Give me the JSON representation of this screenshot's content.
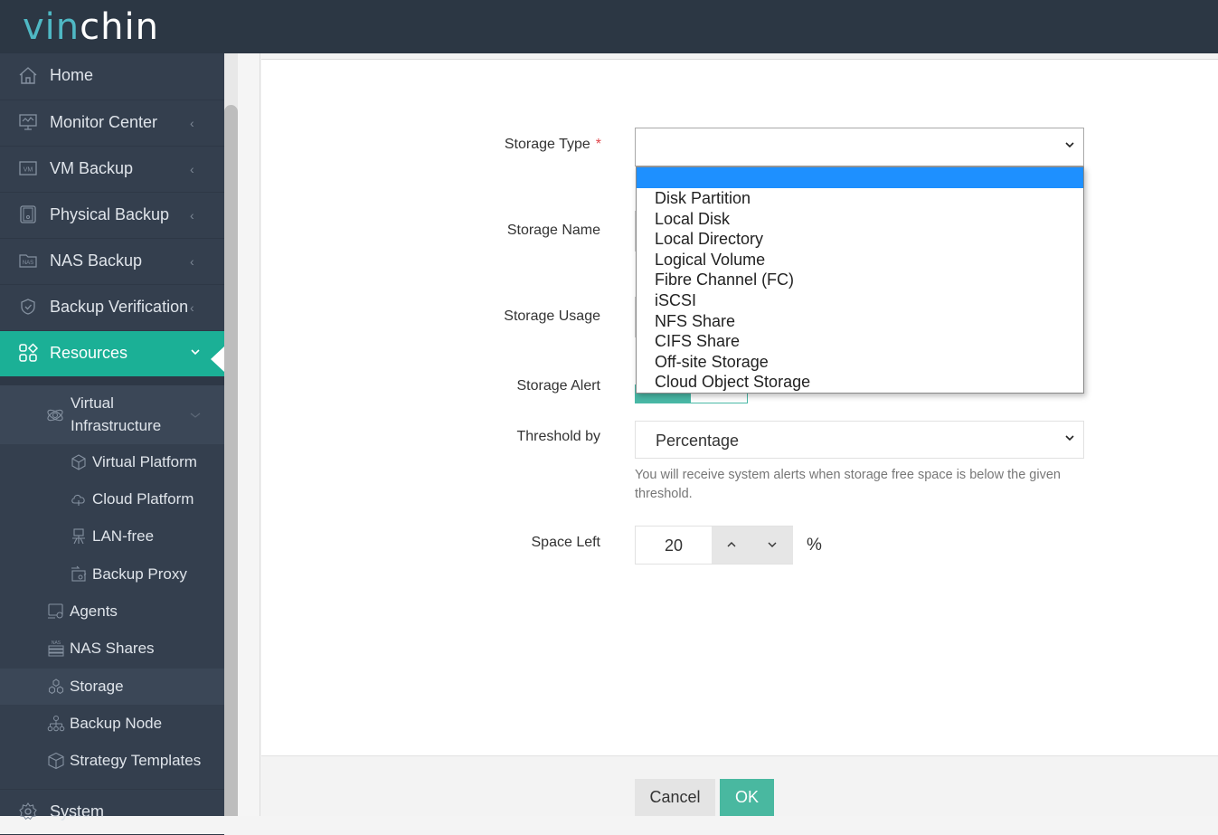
{
  "app": {
    "logo_part1": "vin",
    "logo_part2": "chin"
  },
  "sidebar": {
    "items": [
      {
        "label": "Home",
        "icon": "home-icon",
        "has_chevron": false
      },
      {
        "label": "Monitor Center",
        "icon": "monitor-icon",
        "chevron": "‹"
      },
      {
        "label": "VM Backup",
        "icon": "vm-icon",
        "chevron": "‹"
      },
      {
        "label": "Physical Backup",
        "icon": "server-icon",
        "chevron": "‹"
      },
      {
        "label": "NAS Backup",
        "icon": "nas-icon",
        "chevron": "‹"
      },
      {
        "label": "Backup Verification",
        "icon": "shield-check-icon",
        "chevron": "‹"
      },
      {
        "label": "Resources",
        "icon": "resources-icon",
        "chevron": "⌄",
        "active": true
      }
    ],
    "resources_sub": {
      "group_label_line1": "Virtual",
      "group_label_line2": "Infrastructure",
      "group_children": [
        {
          "label": "Virtual Platform",
          "icon": "cube-icon"
        },
        {
          "label": "Cloud Platform",
          "icon": "cloud-icon"
        },
        {
          "label": "LAN-free",
          "icon": "lan-free-icon"
        },
        {
          "label": "Backup Proxy",
          "icon": "proxy-icon"
        }
      ],
      "items": [
        {
          "label": "Agents",
          "icon": "agent-icon"
        },
        {
          "label": "NAS Shares",
          "icon": "nas-shares-icon"
        },
        {
          "label": "Storage",
          "icon": "storage-icon",
          "selected": true
        },
        {
          "label": "Backup Node",
          "icon": "node-icon"
        },
        {
          "label": "Strategy Templates",
          "icon": "template-icon"
        }
      ]
    },
    "bottom_item": {
      "label": "System",
      "icon": "gear-icon"
    }
  },
  "form": {
    "storage_type": {
      "label": "Storage Type",
      "required_mark": "*",
      "value": ""
    },
    "storage_name": {
      "label": "Storage Name"
    },
    "storage_usage": {
      "label": "Storage Usage"
    },
    "storage_alert": {
      "label": "Storage Alert",
      "enabled": true
    },
    "threshold_by": {
      "label": "Threshold by",
      "value": "Percentage"
    },
    "hint": "You will receive system alerts when storage free space is below the given threshold.",
    "space_left": {
      "label": "Space Left",
      "value": "20",
      "unit": "%"
    }
  },
  "dropdown": {
    "options": [
      "",
      "Disk Partition",
      "Local Disk",
      "Local Directory",
      "Logical Volume",
      "Fibre Channel (FC)",
      "iSCSI",
      "NFS Share",
      "CIFS Share",
      "Off-site Storage",
      "Cloud Object Storage"
    ],
    "highlighted_index": 0
  },
  "footer": {
    "cancel_label": "Cancel",
    "ok_label": "OK"
  },
  "colors": {
    "accent": "#1bb096",
    "topbar": "#2c3744",
    "sidebar": "#343f4e",
    "highlight": "#1e90ff"
  }
}
